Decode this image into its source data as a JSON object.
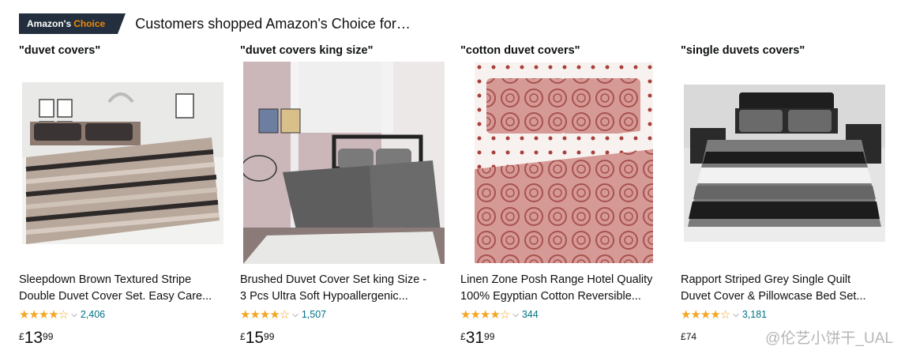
{
  "header": {
    "badge_amazons": "Amazon's",
    "badge_choice": "Choice",
    "title": "Customers shopped Amazon's Choice for…"
  },
  "products": [
    {
      "query": "\"duvet covers\"",
      "title_line1": "Sleepdown Brown Textured Stripe",
      "title_line2": "Double Duvet Cover Set. Easy Care...",
      "stars": "★★★★☆",
      "rating_value": 4.5,
      "review_count": "2,406",
      "price_symbol": "£",
      "price_whole": "13",
      "price_fraction": "99"
    },
    {
      "query": "\"duvet covers king size\"",
      "title_line1": "Brushed Duvet Cover Set king Size -",
      "title_line2": "3 Pcs Ultra Soft Hypoallergenic...",
      "stars": "★★★★☆",
      "rating_value": 4.5,
      "review_count": "1,507",
      "price_symbol": "£",
      "price_whole": "15",
      "price_fraction": "99"
    },
    {
      "query": "\"cotton duvet covers\"",
      "title_line1": "Linen Zone Posh Range Hotel Quality",
      "title_line2": "100% Egyptian Cotton Reversible...",
      "stars": "★★★★☆",
      "rating_value": 4.5,
      "review_count": "344",
      "price_symbol": "£",
      "price_whole": "31",
      "price_fraction": "99"
    },
    {
      "query": "\"single duvets covers\"",
      "title_line1": "Rapport Striped Grey Single Quilt",
      "title_line2": "Duvet Cover & Pillowcase Bed Set...",
      "stars": "★★★★☆",
      "rating_value": 4.5,
      "review_count": "3,181",
      "price_symbol": "£",
      "price_whole": "",
      "price_fraction": "74"
    }
  ],
  "watermark": "@伦艺小饼干_UAL",
  "colors": {
    "badge_bg": "#232f3e",
    "badge_choice": "#f08804",
    "star": "#f5a623",
    "link": "#007185"
  }
}
